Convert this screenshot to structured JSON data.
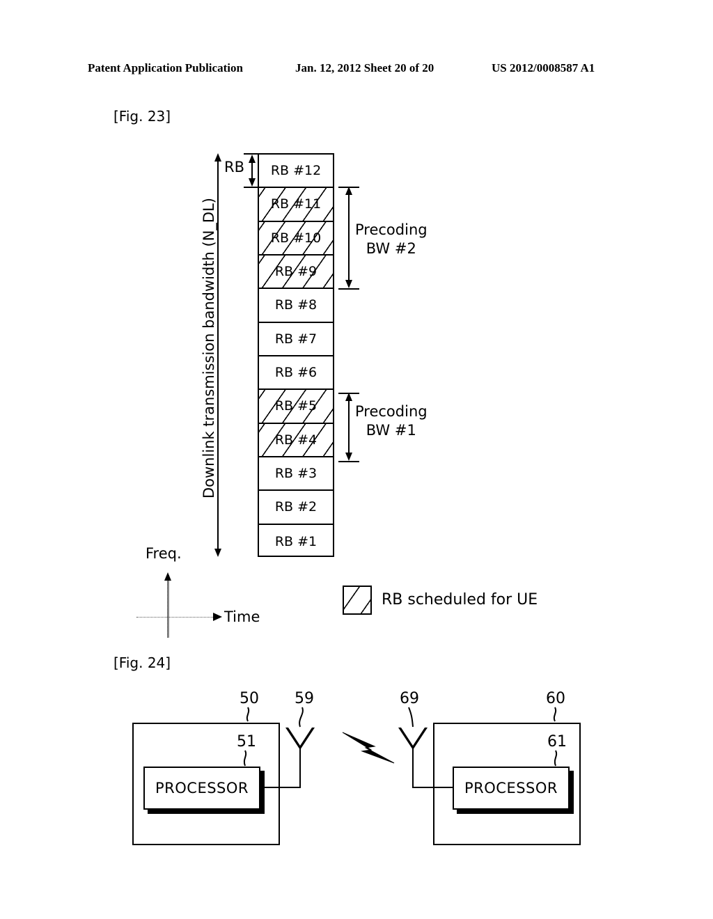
{
  "header": {
    "publication": "Patent Application Publication",
    "date_sheet": "Jan. 12, 2012  Sheet 20 of 20",
    "patent_number": "US 2012/0008587 A1"
  },
  "fig23": {
    "label": "[Fig. 23]",
    "bandwidth_axis_label": "Downlink transmission bandwidth (N_DL)",
    "rb_unit_label": "RB",
    "freq_axis_label": "Freq.",
    "time_axis_label": "Time",
    "legend_label": "RB scheduled for UE",
    "resource_blocks": [
      {
        "label": "RB #12",
        "scheduled": false
      },
      {
        "label": "RB #11",
        "scheduled": true
      },
      {
        "label": "RB #10",
        "scheduled": true
      },
      {
        "label": "RB #9",
        "scheduled": true
      },
      {
        "label": "RB #8",
        "scheduled": false
      },
      {
        "label": "RB #7",
        "scheduled": false
      },
      {
        "label": "RB #6",
        "scheduled": false
      },
      {
        "label": "RB #5",
        "scheduled": true
      },
      {
        "label": "RB #4",
        "scheduled": true
      },
      {
        "label": "RB #3",
        "scheduled": false
      },
      {
        "label": "RB #2",
        "scheduled": false
      },
      {
        "label": "RB #1",
        "scheduled": false
      }
    ],
    "precoding_bw_2": "Precoding\nBW #2",
    "precoding_bw_2_line1": "Precoding",
    "precoding_bw_2_line2": "BW #2",
    "precoding_bw_1_line1": "Precoding",
    "precoding_bw_1_line2": "BW #1"
  },
  "fig24": {
    "label": "[Fig. 24]",
    "left_device_ref": "50",
    "left_processor_ref": "51",
    "left_antenna_ref": "59",
    "right_antenna_ref": "69",
    "right_device_ref": "60",
    "right_processor_ref": "61",
    "processor_label_left": "PROCESSOR",
    "processor_label_right": "PROCESSOR"
  }
}
